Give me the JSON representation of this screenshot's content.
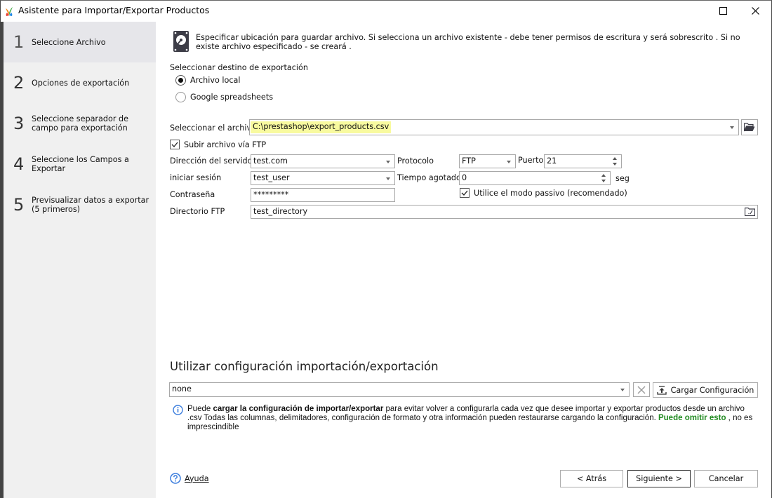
{
  "window": {
    "title": "Asistente para Importar/Exportar Productos",
    "maximize_icon": "maximize-icon",
    "close_icon": "close-icon"
  },
  "sidebar": {
    "steps": [
      {
        "number": "1",
        "label": "Seleccione Archivo",
        "active": true
      },
      {
        "number": "2",
        "label": "Opciones de exportación",
        "active": false
      },
      {
        "number": "3",
        "label": "Seleccione separador de campo para exportación",
        "active": false
      },
      {
        "number": "4",
        "label": "Seleccione los Campos a Exportar",
        "active": false
      },
      {
        "number": "5",
        "label": "Previsualizar datos a exportar (5 primeros)",
        "active": false
      }
    ]
  },
  "main": {
    "info_icon": "hard-drive-icon",
    "info_text": "Especificar ubicación para guardar archivo. Si selecciona un archivo existente - debe tener permisos de escritura y será sobrescrito . Si no existe archivo especificado - se creará .",
    "destination": {
      "label": "Seleccionar destino de exportación",
      "options": [
        {
          "label": "Archivo local",
          "checked": true
        },
        {
          "label": "Google spreadsheets",
          "checked": false
        }
      ]
    },
    "file": {
      "label": "Seleccionar el archivo",
      "value": "C:\\prestashop\\export_products.csv",
      "highlight_color": "#f8fa9f"
    },
    "ftp": {
      "upload_label": "Subir archivo vía FTP",
      "upload_checked": true,
      "server_label": "Dirección del servidor",
      "server_value": "test.com",
      "login_label": "iniciar sesión",
      "login_value": "test_user",
      "password_label": "Contraseña",
      "password_value": "*********",
      "directory_label": "Directorio FTP",
      "directory_value": "test_directory",
      "protocol_label": "Protocolo",
      "protocol_value": "FTP",
      "port_label": "Puerto",
      "port_value": "21",
      "timeout_label": "Tiempo agotado",
      "timeout_value": "0",
      "timeout_unit": "seg",
      "passive_label": "Utilice el modo passivo (recomendado)",
      "passive_checked": true
    },
    "config": {
      "title": "Utilizar configuración importación/exportación",
      "value": "none",
      "load_button": "Cargar Configuración",
      "hint_prefix": "Puede ",
      "hint_bold": "cargar la configuración de importar/exportar",
      "hint_middle": " para evitar volver a configurarla cada vez que desee importar y exportar productos desde un archivo .csv Todas las columnas, delimitadores, configuración de formato y otra información pueden restaurarse cargando la configuración. ",
      "hint_green": "Puede omitir esto",
      "hint_suffix": " , no es imprescindible",
      "accent_green": "#228b22"
    }
  },
  "footer": {
    "help_label": "Ayuda",
    "back_button": "< Atrás",
    "next_button": "Siguiente >",
    "cancel_button": "Cancelar"
  }
}
